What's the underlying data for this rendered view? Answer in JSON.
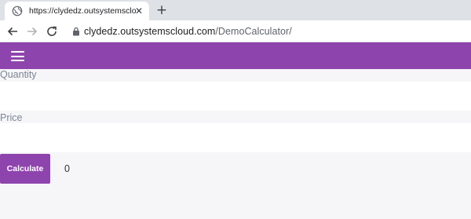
{
  "browser": {
    "tab_title": "https://clydedz.outsystemscloud",
    "tab_close": "✕",
    "new_tab": "+",
    "url_host": "clydedz.outsystemscloud.com",
    "url_path": "/DemoCalculator/"
  },
  "form": {
    "quantity_label": "Quantity",
    "quantity_value": "",
    "price_label": "Price",
    "price_value": "",
    "calculate_label": "Calculate",
    "result": "0"
  },
  "colors": {
    "accent": "#8e44ad",
    "page_bg": "#f6f5f8",
    "label": "#7b8794"
  },
  "icons": {
    "tab": "globe-icon",
    "back": "back-arrow-icon",
    "forward": "forward-arrow-icon",
    "reload": "reload-icon",
    "secure": "lock-icon",
    "menu": "hamburger-menu-icon"
  }
}
